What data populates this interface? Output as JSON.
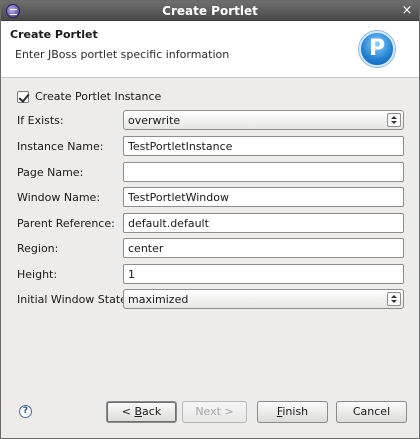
{
  "window": {
    "title": "Create Portlet"
  },
  "banner": {
    "title": "Create Portlet",
    "description": "Enter JBoss portlet specific information",
    "logo_letter": "P"
  },
  "form": {
    "create_instance": {
      "label": "Create Portlet Instance",
      "checked": true
    },
    "if_exists": {
      "label": "If Exists:",
      "value": "overwrite"
    },
    "instance_name": {
      "label": "Instance Name:",
      "value": "TestPortletInstance"
    },
    "page_name": {
      "label": "Page Name:",
      "value": ""
    },
    "window_name": {
      "label": "Window Name:",
      "value": "TestPortletWindow"
    },
    "parent_reference": {
      "label": "Parent Reference:",
      "value": "default.default"
    },
    "region": {
      "label": "Region:",
      "value": "center"
    },
    "height": {
      "label": "Height:",
      "value": "1"
    },
    "initial_window_state": {
      "label": "Initial Window State:",
      "value": "maximized"
    }
  },
  "buttons": {
    "help_glyph": "?",
    "back": {
      "prefix": "< ",
      "mnemonic": "B",
      "rest": "ack"
    },
    "next": {
      "label": "Next >"
    },
    "finish": {
      "mnemonic": "F",
      "rest": "inish"
    },
    "cancel": {
      "label": "Cancel"
    }
  }
}
